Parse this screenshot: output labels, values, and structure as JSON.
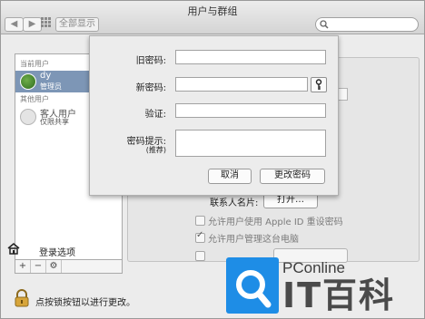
{
  "window": {
    "title": "用户与群组"
  },
  "toolbar": {
    "back_glyph": "◀",
    "forward_glyph": "▶",
    "show_all_label": "全部显示",
    "search_placeholder": ""
  },
  "sidebar": {
    "current_users_label": "当前用户",
    "other_users_label": "其他用户",
    "users": [
      {
        "name": "dy",
        "role": "管理员",
        "selected": true
      },
      {
        "name": "客人用户",
        "role": "仅限共享",
        "selected": false
      }
    ],
    "login_options_label": "登录选项",
    "add_glyph": "+",
    "remove_glyph": "−",
    "gear_glyph": "⚙"
  },
  "password_sheet": {
    "old_password_label": "旧密码:",
    "new_password_label": "新密码:",
    "verify_label": "验证:",
    "hint_label": "密码提示:",
    "hint_note": "(推荐)",
    "old_password_value": "",
    "new_password_value": "",
    "verify_value": "",
    "hint_value": "",
    "cancel_label": "取消",
    "change_label": "更改密码"
  },
  "main": {
    "contact_card_label": "联系人名片:",
    "open_label": "打开…",
    "allow_apple_id_label": "允许用户使用 Apple ID 重设密码",
    "allow_admin_label": "允许用户管理这台电脑",
    "allow_apple_id_checked": false,
    "allow_admin_checked": true
  },
  "lock": {
    "text": "点按锁按钮以进行更改。"
  },
  "watermark": {
    "brand": "PConline",
    "cn": "IT百科"
  },
  "colors": {
    "selection": "#7d96b6",
    "watermark_blue": "#1e8de6"
  }
}
